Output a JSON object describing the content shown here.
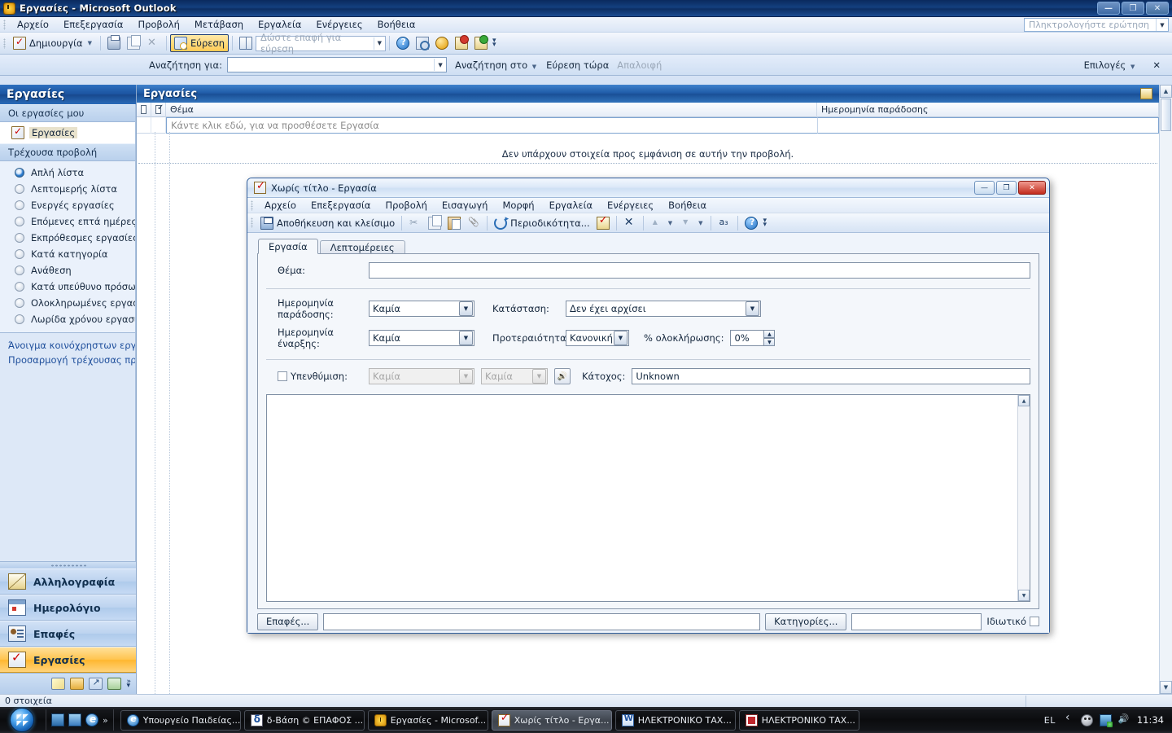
{
  "main_window": {
    "title": "Εργασίες - Microsoft Outlook",
    "window_buttons": {
      "minimize": "—",
      "restore": "❐",
      "close": "✕"
    },
    "menu": [
      "Αρχείο",
      "Επεξεργασία",
      "Προβολή",
      "Μετάβαση",
      "Εργαλεία",
      "Ενέργειες",
      "Βοήθεια"
    ],
    "ask_box_placeholder": "Πληκτρολογήστε ερώτηση",
    "toolbar": {
      "new_label": "Δημιουργία",
      "find_label": "Εύρεση",
      "contact_search_placeholder": "Δώστε επαφή για εύρεση"
    },
    "search_pane": {
      "search_for_label": "Αναζήτηση για:",
      "search_value": "",
      "search_in_label": "Αναζήτηση στο",
      "find_now_label": "Εύρεση τώρα",
      "clear_label": "Απαλοιφή",
      "options_label": "Επιλογές",
      "close_label": "✕"
    },
    "statusbar": {
      "items_count": "0 στοιχεία"
    }
  },
  "nav": {
    "header": "Εργασίες",
    "my_tasks_group": "Οι εργασίες μου",
    "folders": [
      {
        "label": "Εργασίες",
        "selected": true
      }
    ],
    "current_view_group": "Τρέχουσα προβολή",
    "views": [
      {
        "label": "Απλή λίστα",
        "selected": true
      },
      {
        "label": "Λεπτομερής λίστα",
        "selected": false
      },
      {
        "label": "Ενεργές εργασίες",
        "selected": false
      },
      {
        "label": "Επόμενες επτά ημέρες",
        "selected": false
      },
      {
        "label": "Εκπρόθεσμες εργασίες",
        "selected": false
      },
      {
        "label": "Κατά κατηγορία",
        "selected": false
      },
      {
        "label": "Ανάθεση",
        "selected": false
      },
      {
        "label": "Κατά υπεύθυνο πρόσωπο",
        "selected": false
      },
      {
        "label": "Ολοκληρωμένες εργασίες",
        "selected": false
      },
      {
        "label": "Λωρίδα χρόνου εργασιών",
        "selected": false
      }
    ],
    "links": [
      "Άνοιγμα κοινόχρηστων εργασιών",
      "Προσαρμογή τρέχουσας προβολής"
    ],
    "modules": [
      {
        "label": "Αλληλογραφία",
        "active": false
      },
      {
        "label": "Ημερολόγιο",
        "active": false
      },
      {
        "label": "Επαφές",
        "active": false
      },
      {
        "label": "Εργασίες",
        "active": true
      }
    ]
  },
  "list": {
    "header": "Εργασίες",
    "columns": [
      "Θέμα",
      "Ημερομηνία παράδοσης"
    ],
    "new_item_row": "Κάντε κλικ εδώ, για να προσθέσετε Εργασία",
    "empty_message": "Δεν υπάρχουν στοιχεία προς εμφάνιση σε αυτήν την προβολή."
  },
  "dialog": {
    "title": "Χωρίς τίτλο - Εργασία",
    "window_buttons": {
      "minimize": "—",
      "maximize": "❐",
      "close": "✕"
    },
    "menu": [
      "Αρχείο",
      "Επεξεργασία",
      "Προβολή",
      "Εισαγωγή",
      "Μορφή",
      "Εργαλεία",
      "Ενέργειες",
      "Βοήθεια"
    ],
    "toolbar": {
      "save_close_label": "Αποθήκευση και κλείσιμο",
      "recurrence_label": "Περιοδικότητα..."
    },
    "tabs": [
      {
        "label": "Εργασία",
        "active": true
      },
      {
        "label": "Λεπτομέρειες",
        "active": false
      }
    ],
    "fields": {
      "subject_label": "Θέμα:",
      "subject_value": "",
      "due_date_label": "Ημερομηνία παράδοσης:",
      "due_date_value": "Καμία",
      "start_date_label": "Ημερομηνία έναρξης:",
      "start_date_value": "Καμία",
      "status_label": "Κατάσταση:",
      "status_value": "Δεν έχει αρχίσει",
      "priority_label": "Προτεραιότητα:",
      "priority_value": "Κανονική",
      "percent_label": "% ολοκλήρωσης:",
      "percent_value": "0%",
      "reminder_label": "Υπενθύμιση:",
      "reminder_date_value": "Καμία",
      "reminder_time_value": "Καμία",
      "owner_label": "Κάτοχος:",
      "owner_value": "Unknown",
      "notes_value": ""
    },
    "footer": {
      "contacts_label": "Επαφές...",
      "contacts_value": "",
      "categories_label": "Κατηγορίες...",
      "categories_value": "",
      "private_label": "Ιδιωτικό"
    }
  },
  "taskbar": {
    "buttons": [
      {
        "label": "Υπουργείο Παιδείας...",
        "icon": "ie-icon",
        "active": false
      },
      {
        "label": "δ-Βάση © ΕΠΑΦΟΣ ...",
        "icon": "delta-icon",
        "active": false
      },
      {
        "label": "Εργασίες - Microsof...",
        "icon": "outlook-icon",
        "active": false
      },
      {
        "label": "Χωρίς τίτλο - Εργα...",
        "icon": "task-icon",
        "active": true
      },
      {
        "label": "ΗΛΕΚΤΡΟΝΙΚΟ ΤΑΧ...",
        "icon": "word-icon",
        "active": false
      },
      {
        "label": "ΗΛΕΚΤΡΟΝΙΚΟ ΤΑΧ...",
        "icon": "pdf-icon",
        "active": false
      }
    ],
    "tray": {
      "language": "EL",
      "clock": "11:34"
    }
  }
}
